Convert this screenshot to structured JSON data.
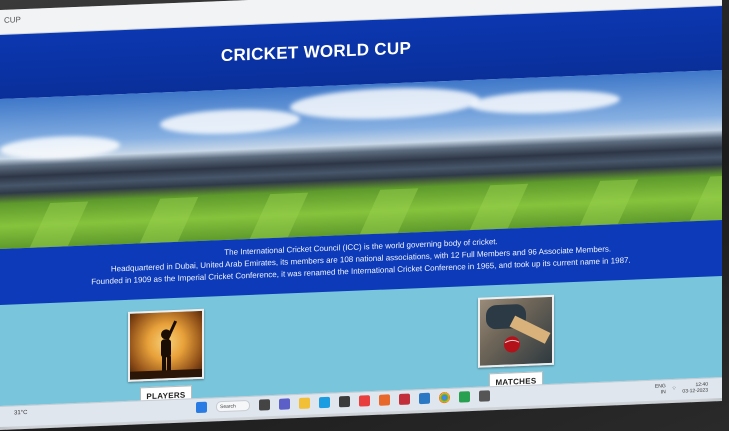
{
  "window": {
    "title": "CUP",
    "controls": [
      "—",
      "☐",
      "✕"
    ]
  },
  "header": {
    "title": "CRICKET WORLD CUP"
  },
  "info": {
    "lines": [
      "The International Cricket Council (ICC) is the world governing body of cricket.",
      "Headquartered in Dubai, United Arab Emirates, its members are 108 national associations, with 12 Full Members and 96 Associate Members.",
      "Founded in 1909 as the Imperial Cricket Conference, it was renamed the International Cricket Conference in 1965, and took up its current name in 1987."
    ]
  },
  "cards": {
    "players": {
      "label": "PLAYERS",
      "icon": "batsman-silhouette-image"
    },
    "matches": {
      "label": "MATCHES",
      "icon": "cricket-ball-bat-image"
    }
  },
  "taskbar": {
    "weather": "31°C",
    "search": "Search",
    "lang": "ENG",
    "region": "IN",
    "time": "12:40",
    "date": "03-12-2023",
    "icons": [
      "windows-icon",
      "search-icon",
      "task-view-icon",
      "chat-icon",
      "explorer-icon",
      "edge-icon",
      "store-icon",
      "app-icon",
      "app-icon",
      "vscode-icon",
      "chrome-icon",
      "app-icon",
      "app-icon"
    ],
    "colors": {
      "accent": "#0c3ab8",
      "content_bg": "#79c6dc"
    }
  }
}
